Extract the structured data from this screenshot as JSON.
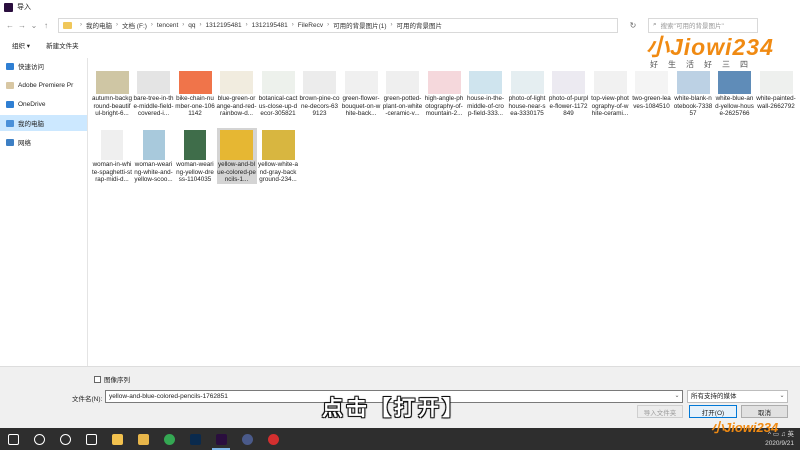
{
  "window": {
    "title": "导入"
  },
  "address": {
    "crumbs": [
      "我的电脑",
      "文档 (F:)",
      "tencent",
      "qq",
      "1312195481",
      "1312195481",
      "FileRecv",
      "可用的背景图片(1)",
      "可用的背景图片"
    ]
  },
  "search": {
    "placeholder": "搜索\"可用的背景图片\""
  },
  "toolbar": {
    "organize": "组织 ▾",
    "new_folder": "新建文件夹"
  },
  "sidebar": {
    "items": [
      {
        "label": "快速访问",
        "icon": "star-icon",
        "color": "#2f7fd3"
      },
      {
        "label": "Adobe Premiere Pr",
        "icon": "folder-icon",
        "color": "#d8c7a3"
      },
      {
        "label": "OneDrive",
        "icon": "cloud-icon",
        "color": "#2f7fd3"
      },
      {
        "label": "我的电脑",
        "icon": "computer-icon",
        "color": "#4a90d9",
        "selected": true
      },
      {
        "label": "网络",
        "icon": "network-icon",
        "color": "#3d7fc4"
      }
    ]
  },
  "files": [
    {
      "name": "autumn-background-beautiful-bright-6...",
      "color": "#cfc6a4"
    },
    {
      "name": "bare-tree-in-the-middle-field-covered-i...",
      "color": "#e4e4e4"
    },
    {
      "name": "bike-chain-number-one-1061142",
      "color": "#f0744a"
    },
    {
      "name": "blue-green-orange-and-red-rainbow-d...",
      "color": "#f1ecdf"
    },
    {
      "name": "botanical-cactus-close-up-decor-305821",
      "color": "#edf1ec"
    },
    {
      "name": "brown-pine-cone-decors-639123",
      "color": "#ececec"
    },
    {
      "name": "green-flower-bouquet-on-white-back...",
      "color": "#f0f0f0"
    },
    {
      "name": "green-potted-plant-on-white-ceramic-v...",
      "color": "#efefef"
    },
    {
      "name": "high-angle-photography-of-mountain-2...",
      "color": "#f5d8dc"
    },
    {
      "name": "house-in-the-middle-of-crop-field-333...",
      "color": "#cfe4ee"
    },
    {
      "name": "photo-of-lighthouse-near-sea-3330175",
      "color": "#e5eef1"
    },
    {
      "name": "photo-of-purple-flower-1172849",
      "color": "#eceaf1"
    },
    {
      "name": "top-view-photography-of-white-cerami...",
      "color": "#f1f1f1"
    },
    {
      "name": "two-green-leaves-1084510",
      "color": "#f4f4f4"
    },
    {
      "name": "white-blank-notebook-733857",
      "color": "#bcd1e4"
    },
    {
      "name": "white-blue-and-yellow-house-2625766",
      "color": "#5f8cb8"
    },
    {
      "name": "white-painted-wall-2662792",
      "color": "#eef0ee"
    },
    {
      "name": "woman-in-white-spaghetti-strap-midi-d...",
      "color": "#efefef"
    },
    {
      "name": "woman-wearing-white-and-yellow-scoo...",
      "color": "#a8c9dc"
    },
    {
      "name": "woman-wearing-yellow-dress-1104035",
      "color": "#3f6d4a"
    },
    {
      "name": "yellow-and-blue-colored-pencils-1...",
      "color": "#e6b733",
      "selected": true
    },
    {
      "name": "yellow-white-and-gray-background-234...",
      "color": "#d8b640"
    }
  ],
  "bottom": {
    "image_sequence_label": "图像序列",
    "filename_label": "文件名(N):",
    "filename_value": "yellow-and-blue-colored-pencils-1762851",
    "file_type": "所有支持的媒体",
    "import_folder_button": "导入文件夹",
    "open_button": "打开(O)",
    "cancel_button": "取消"
  },
  "overlay_caption": "点击【打开】",
  "logo": {
    "main": "小Jiowi234",
    "sub": "好生活好三四"
  },
  "taskbar": {
    "time": "2020/9/21",
    "icons": [
      {
        "name": "windows-start-icon",
        "color": "#ffffff"
      },
      {
        "name": "search-icon",
        "color": "#ffffff"
      },
      {
        "name": "cortana-icon",
        "color": "#ffffff"
      },
      {
        "name": "task-view-icon",
        "color": "#ffffff"
      },
      {
        "name": "file-explorer-icon",
        "color": "#f2c14e"
      },
      {
        "name": "folder-icon",
        "color": "#e8b64a"
      },
      {
        "name": "chrome-icon",
        "color": "#34a853"
      },
      {
        "name": "photoshop-icon",
        "color": "#0a2a4d"
      },
      {
        "name": "premiere-icon",
        "color": "#2a0e3e"
      },
      {
        "name": "cinema-icon",
        "color": "#4a5a8a"
      },
      {
        "name": "recorder-icon",
        "color": "#d32f2f"
      }
    ]
  }
}
